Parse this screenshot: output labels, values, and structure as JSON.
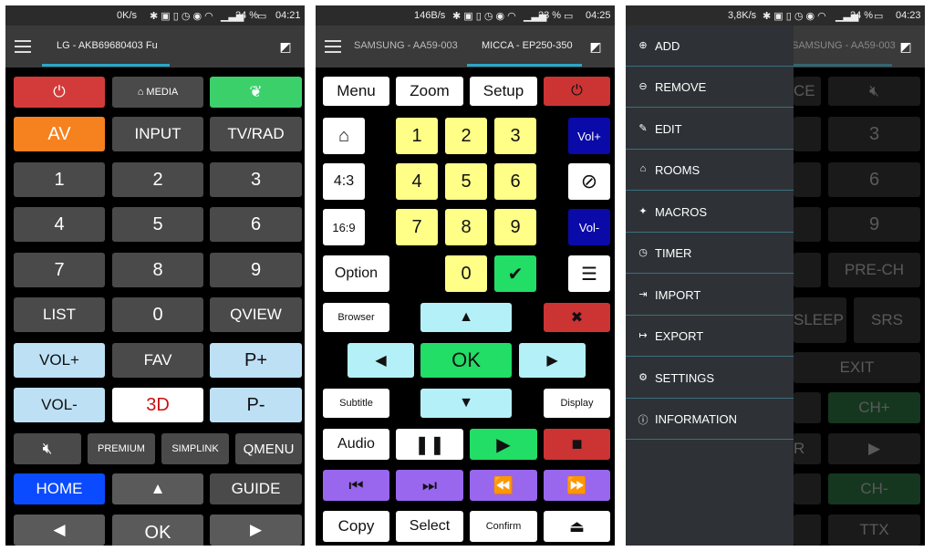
{
  "p1": {
    "status": {
      "net": "0K/s",
      "battery": "24 %",
      "time": "04:21"
    },
    "tab": "LG - AKB69680403 Fu",
    "keys": [
      "MEDIA",
      "AV",
      "INPUT",
      "TV/RAD",
      "1",
      "2",
      "3",
      "4",
      "5",
      "6",
      "7",
      "8",
      "9",
      "LIST",
      "0",
      "QVIEW",
      "VOL+",
      "FAV",
      "P+",
      "VOL-",
      "3D",
      "P-",
      "PREMIUM",
      "SIMPLINK",
      "QMENU",
      "HOME",
      "GUIDE",
      "OK"
    ]
  },
  "p2": {
    "status": {
      "net": "146B/s",
      "battery": "23 %",
      "time": "04:25"
    },
    "tabs": [
      "SAMSUNG - AA59-003",
      "MICCA - EP250-350"
    ],
    "keys": [
      "Menu",
      "Zoom",
      "Setup",
      "1",
      "2",
      "3",
      "Vol+",
      "4:3",
      "4",
      "5",
      "6",
      "16:9",
      "7",
      "8",
      "9",
      "Vol-",
      "Option",
      "0",
      "Browser",
      "OK",
      "Subtitle",
      "Display",
      "Audio",
      "Copy",
      "Select",
      "Confirm"
    ]
  },
  "p3": {
    "status": {
      "net": "3,8K/s",
      "battery": "24 %",
      "time": "04:23"
    },
    "tab": "SAMSUNG - AA59-003",
    "menu": [
      "ADD",
      "REMOVE",
      "EDIT",
      "ROOMS",
      "MACROS",
      "TIMER",
      "IMPORT",
      "EXPORT",
      "SETTINGS",
      "INFORMATION"
    ],
    "bg": [
      "CE",
      "3",
      "6",
      "9",
      "PRE-CH",
      "SLEEP",
      "SRS",
      "EXIT",
      "CH+",
      "R",
      "CH-",
      "TTX"
    ]
  },
  "colors": {
    "accent": "#2aa7c9",
    "green": "#3cd06b",
    "red": "#d33b3b",
    "orange": "#f5821f",
    "blue": "#0b4bff"
  }
}
